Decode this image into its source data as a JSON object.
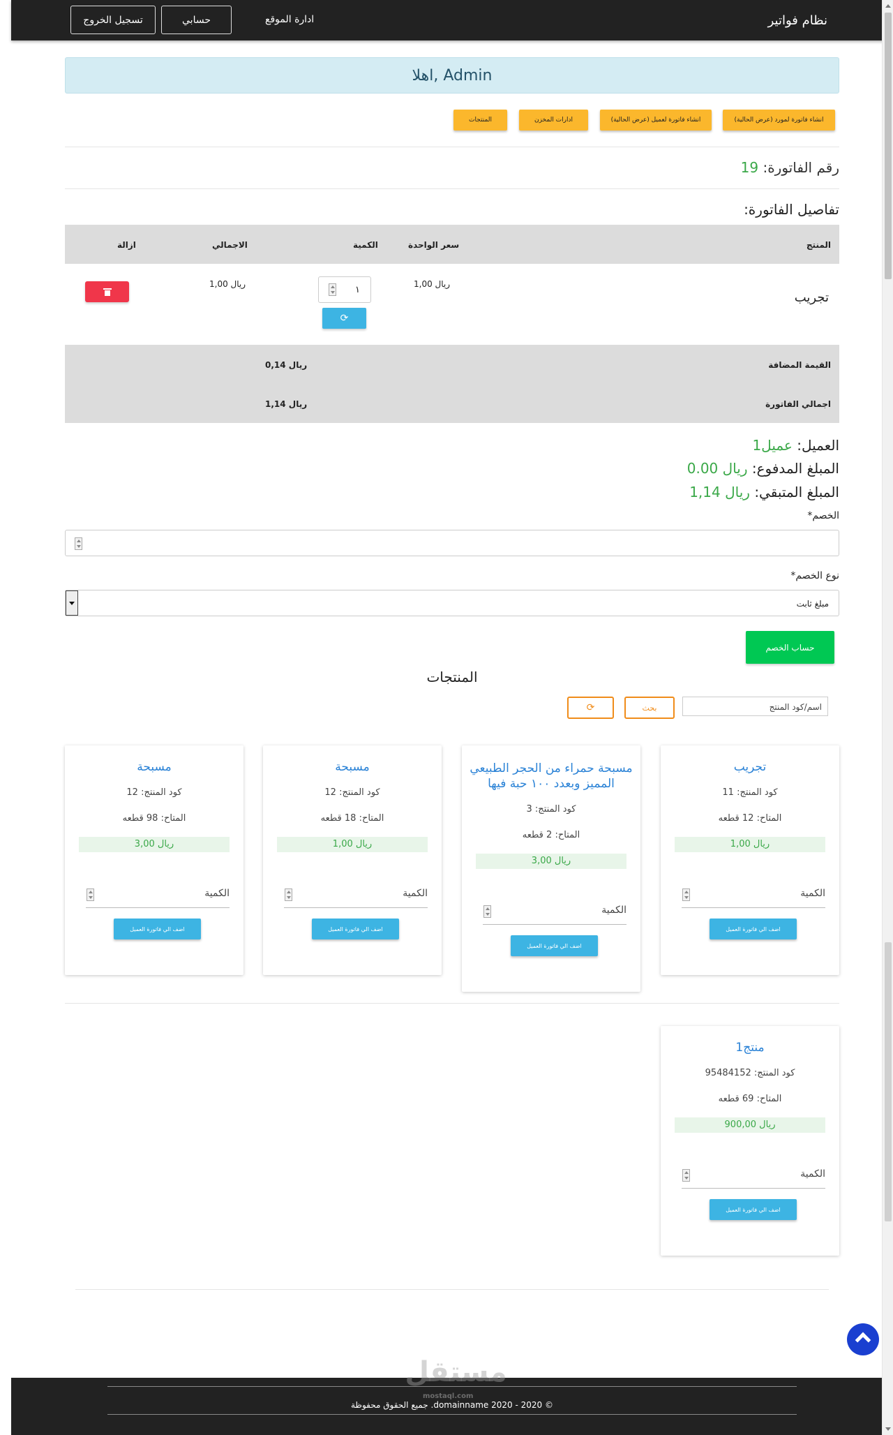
{
  "navbar": {
    "brand": "نظام فواتير",
    "admin_link": "ادارة الموقع",
    "account_btn": "حسابي",
    "logout_btn": "تسجيل الخروج"
  },
  "welcome": "اهلا, Admin",
  "actions": {
    "supplier_invoice": "انشاء فاتورة لمورد (عرض الحالية)",
    "client_invoice": "انشاء فاتورة لعميل (عرض الحالية)",
    "warehouse": "ادارات المخزن",
    "products": "المنتجات"
  },
  "invoice": {
    "number_label": "رقم الفاتورة:",
    "number": "19",
    "details_title": "تفاصيل الفاتورة:",
    "columns": {
      "product": "المنتج",
      "unit_price": "سعر الواحدة",
      "quantity": "الكمية",
      "total": "الاجمالي",
      "remove": "ازالة"
    },
    "rows": [
      {
        "product": "تجريب",
        "unit_price": "ريال 1,00",
        "quantity": "١",
        "total": "ريال 1,00"
      }
    ],
    "vat_label": "القيمة المضافة",
    "vat_value": "ريال 0,14",
    "grand_total_label": "اجمالي الفاتورة",
    "grand_total_value": "ريال 1,14"
  },
  "summary": {
    "client_label": "العميل:",
    "client_value": "عميل1",
    "paid_label": "المبلغ المدفوع:",
    "paid_value": "ريال 0.00",
    "remaining_label": "المبلغ المتبقي:",
    "remaining_value": "ريال 1,14"
  },
  "discount": {
    "label": "الخصم*",
    "value": "",
    "type_label": "نوع الخصم*",
    "type_value": "مبلغ ثابت",
    "calc_btn": "حساب الخصم"
  },
  "products_section": {
    "title": "المنتجات",
    "search_placeholder": "اسم/كود المنتج",
    "search_btn": "بحث",
    "refresh_icon": "refresh-icon"
  },
  "cards": [
    {
      "title": "تجريب",
      "code": "كود المنتج: 11",
      "stock": "المتاح: 12 قطعه",
      "price": "ريال 1,00",
      "qty_label": "الكمية",
      "btn": "اضف الي فاتورة العميل"
    },
    {
      "title": "مسبحة حمراء من الحجر الطبيعي المميز وبعدد ١٠٠ حبة فيها",
      "code": "كود المنتج: 3",
      "stock": "المتاح: 2 قطعه",
      "price": "ريال 3,00",
      "qty_label": "الكمية",
      "btn": "اضف الي فاتورة العميل"
    },
    {
      "title": "مسبحة",
      "code": "كود المنتج: 12",
      "stock": "المتاح: 18 قطعه",
      "price": "ريال 1,00",
      "qty_label": "الكمية",
      "btn": "اضف الي فاتورة العميل"
    },
    {
      "title": "مسبحة",
      "code": "كود المنتج: 12",
      "stock": "المتاح: 98 قطعه",
      "price": "ريال 3,00",
      "qty_label": "الكمية",
      "btn": "اضف الي فاتورة العميل"
    },
    {
      "title": "منتج1",
      "code": "كود المنتج: 95484152",
      "stock": "المتاح: 69 قطعه",
      "price": "ريال 900,00",
      "qty_label": "الكمية",
      "btn": "اضف الي فاتورة العميل"
    }
  ],
  "footer": {
    "text": "© 2020 - 2020 domainname. جميع الحقوق محفوظة"
  },
  "watermark": {
    "main": "مستقل",
    "sub": "mostaql.com"
  },
  "colors": {
    "navbar": "#222222",
    "accent_yellow": "#fbb72c",
    "accent_blue": "#3db4e3",
    "success_green": "#00c853",
    "danger_red": "#f0364a",
    "link_blue": "#2a82d6"
  }
}
